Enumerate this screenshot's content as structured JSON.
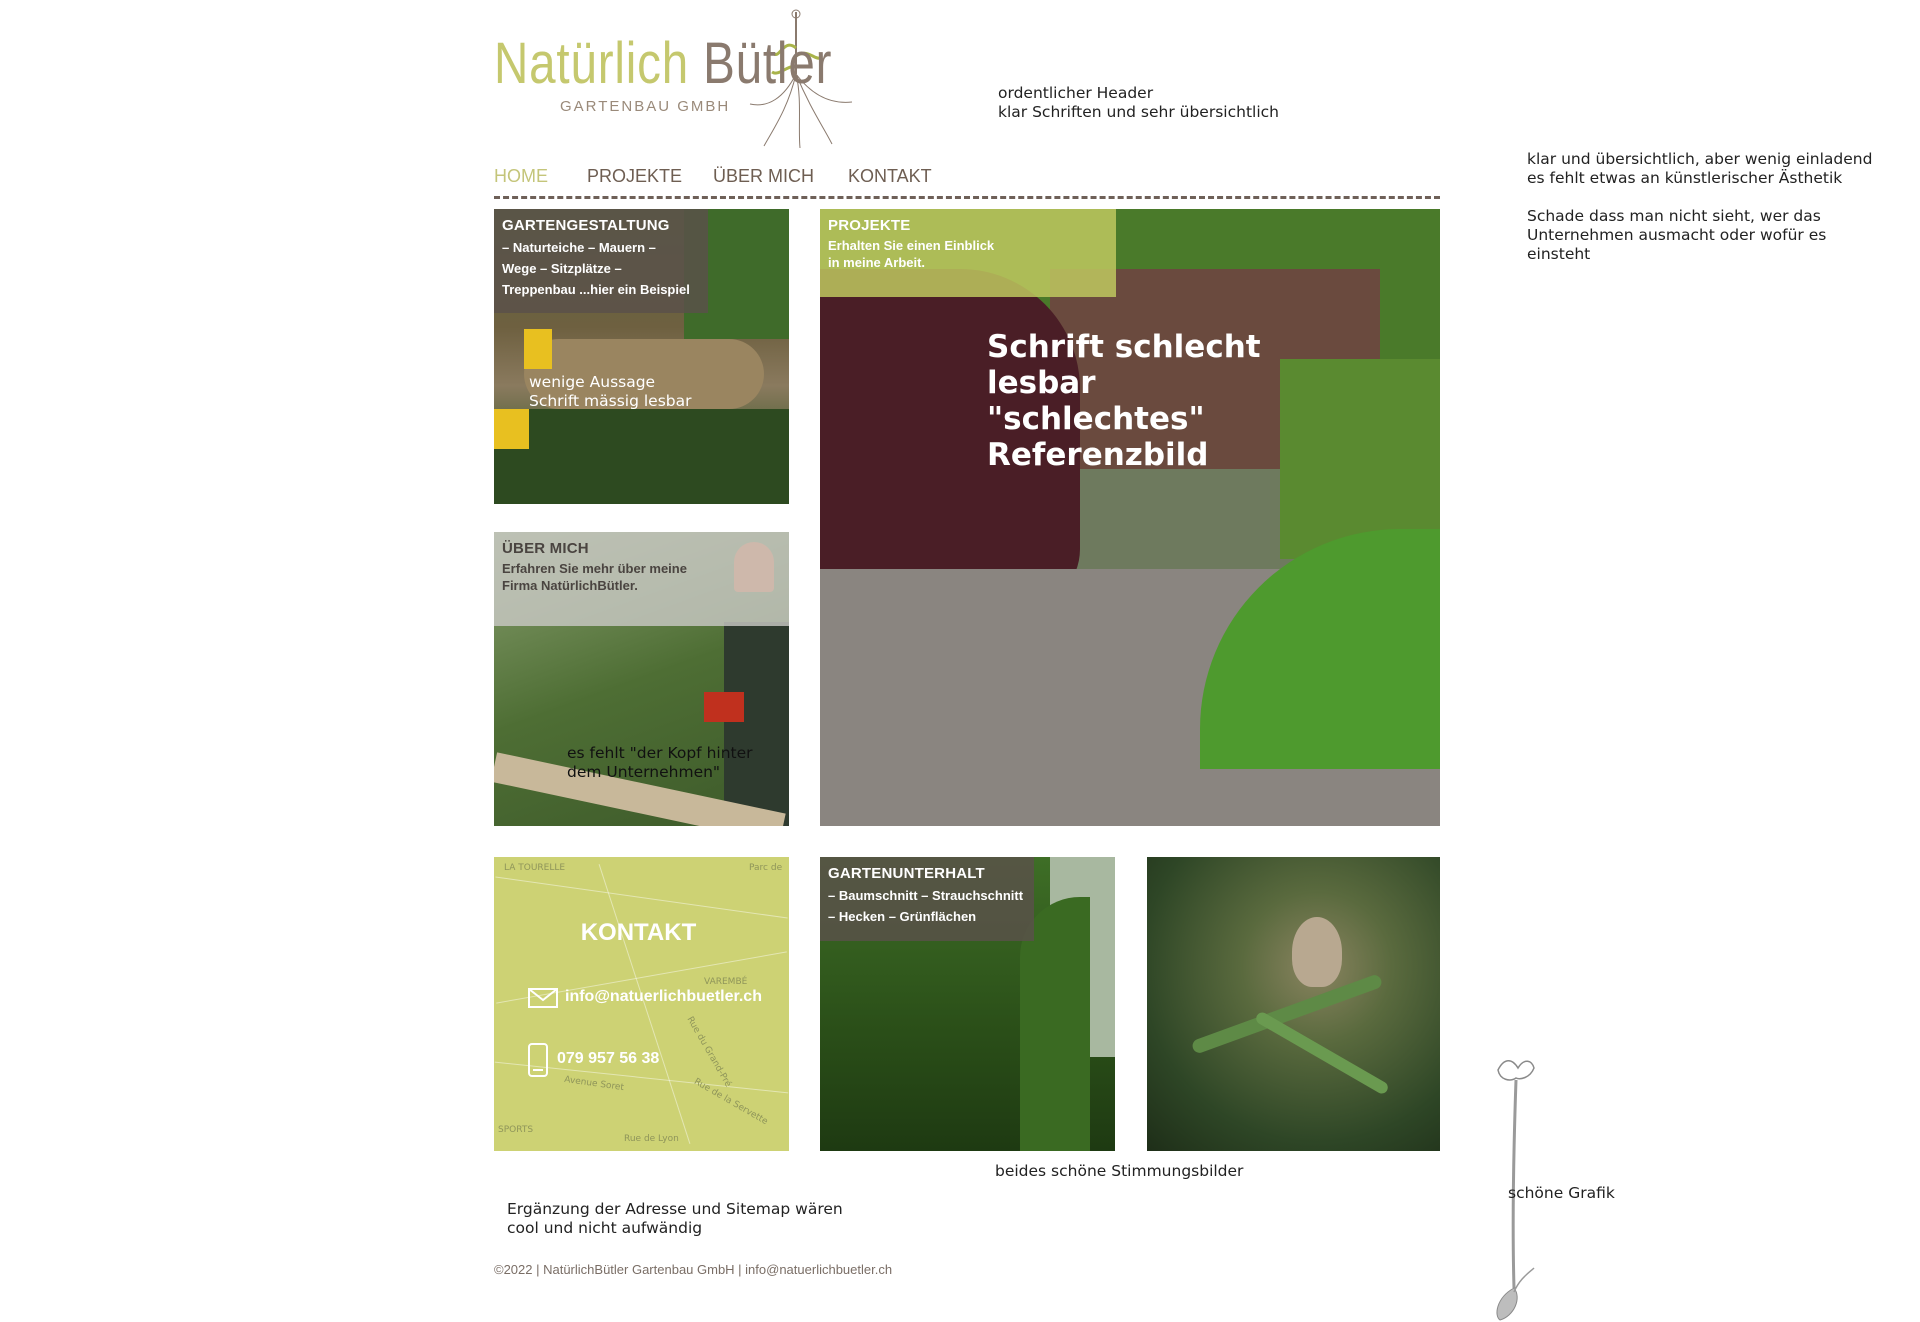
{
  "logo": {
    "word1": "Natürlich",
    "word2": "Bütler",
    "subtitle": "GARTENBAU GMBH"
  },
  "nav": [
    {
      "label": "HOME"
    },
    {
      "label": "PROJEKTE"
    },
    {
      "label": "ÜBER MICH"
    },
    {
      "label": "KONTAKT"
    }
  ],
  "tiles": {
    "gartengestaltung": {
      "title": "GARTENGESTALTUNG",
      "text": "– Naturteiche – Mauern –\nWege – Sitzplätze –\nTreppenbau ...hier ein Beispiel"
    },
    "projekte": {
      "title": "PROJEKTE",
      "text": "Erhalten Sie einen Einblick\nin meine Arbeit."
    },
    "ueber_mich": {
      "title": "ÜBER MICH",
      "text": "Erfahren Sie mehr über meine\nFirma NatürlichBütler."
    },
    "kontakt": {
      "title": "KONTAKT",
      "email": "info@natuerlichbuetler.ch",
      "phone": "079 957 56 38",
      "map_labels": [
        "LA TOURELLE",
        "VAREMBÉ",
        "Parc de",
        "Avenue Soret",
        "Rue du Grand-Pré",
        "Rue de la Servette",
        "Rue de Lyon",
        "SPORTS"
      ]
    },
    "gartenunterhalt": {
      "title": "GARTENUNTERHALT",
      "text": "– Baumschnitt – Strauchschnitt\n– Hecken – Grünflächen"
    }
  },
  "annotations": {
    "header": "ordentlicher Header\nklar Schriften und sehr übersichtlich",
    "overall": "klar und übersichtlich, aber wenig einladend\nes fehlt etwas an künstlerischer Ästhetik\n\nSchade dass man nicht sieht, wer das\nUnternehmen ausmacht oder wofür es\neinsteht",
    "gartengestaltung": "wenige Aussage\nSchrift mässig lesbar",
    "projekte": "Schrift schlecht\nlesbar\n\"schlechtes\"\nReferenzbild",
    "ueber_mich": "es fehlt \"der Kopf hinter\ndem Unternehmen\"",
    "mood": "beides schöne Stimmungsbilder",
    "footer": "Ergänzung der Adresse und Sitemap wären\ncool und nicht aufwändig",
    "graphic": "schöne Grafik"
  },
  "footer": {
    "text": "©2022 | NatürlichBütler Gartenbau GmbH | info@natuerlichbuetler.ch"
  },
  "colors": {
    "accent_green": "#c4c57a",
    "brand_brown": "#6e5e52"
  }
}
